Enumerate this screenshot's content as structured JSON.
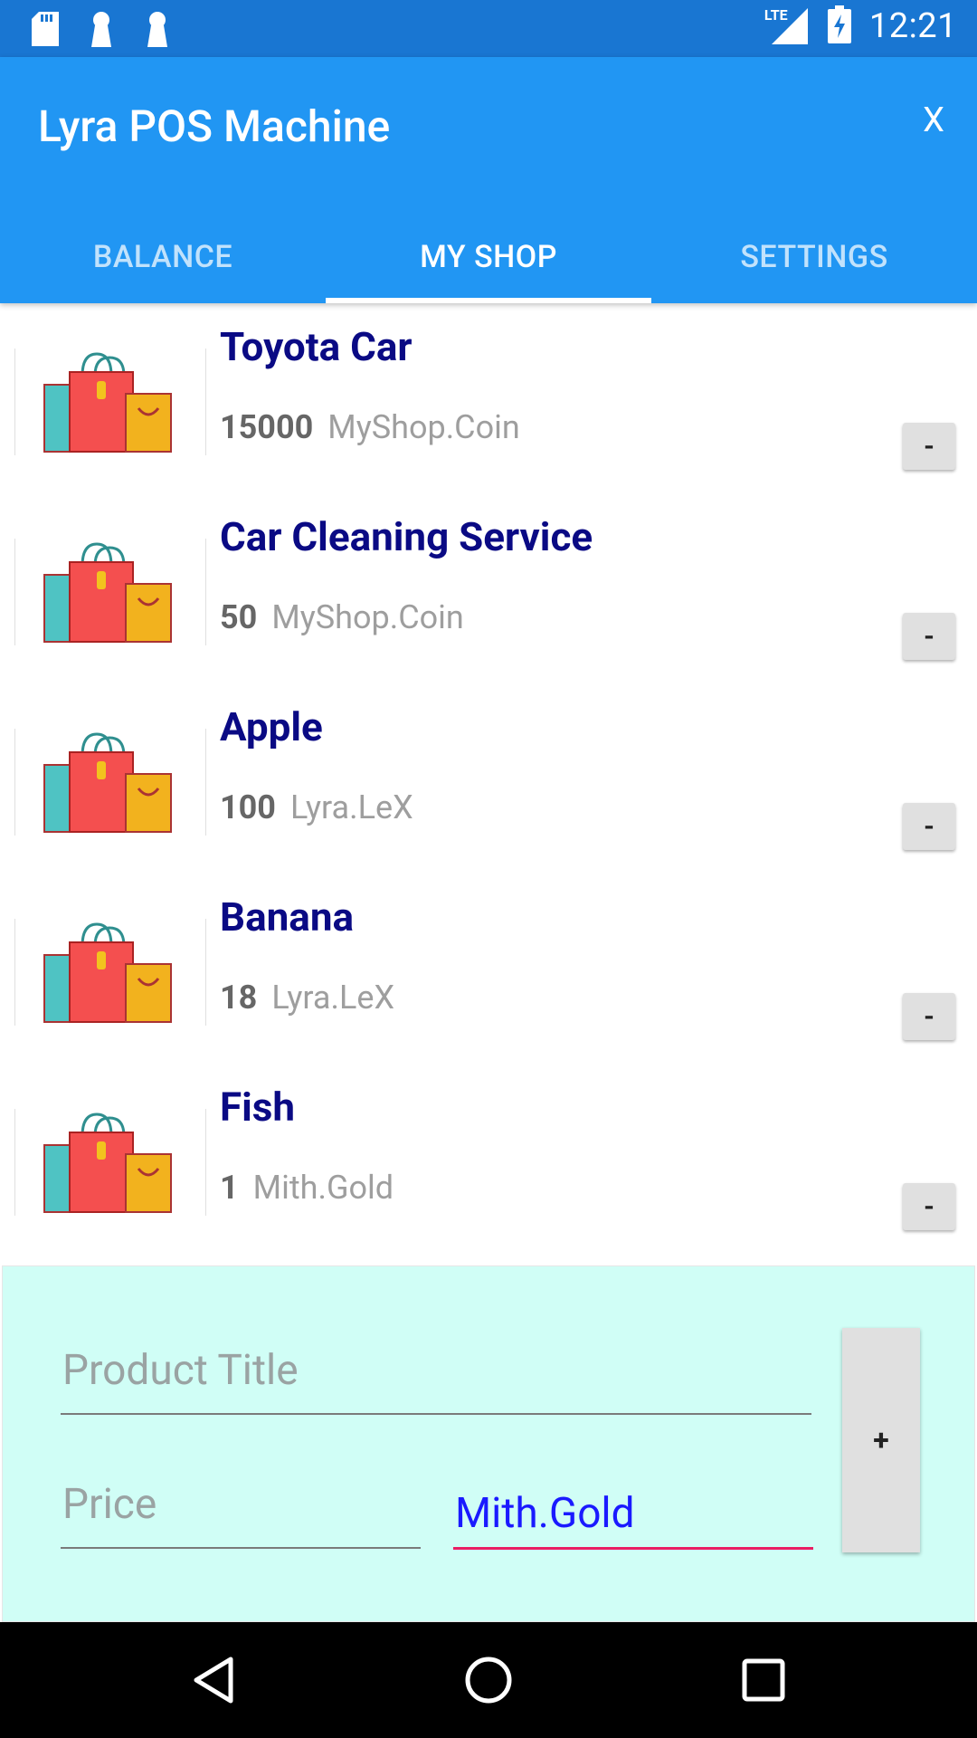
{
  "status_bar": {
    "time": "12:21",
    "network": "LTE",
    "icons": [
      "sd-card-icon",
      "notification-icon",
      "notification-icon",
      "signal-icon",
      "battery-charging-icon"
    ]
  },
  "app_bar": {
    "title": "Lyra POS Machine",
    "close_label": "X"
  },
  "tabs": [
    {
      "label": "BALANCE",
      "active": false
    },
    {
      "label": "MY SHOP",
      "active": true
    },
    {
      "label": "SETTINGS",
      "active": false
    }
  ],
  "products": [
    {
      "title": "Toyota Car",
      "price": "15000",
      "currency": "MyShop.Coin",
      "remove_label": "-"
    },
    {
      "title": "Car Cleaning Service",
      "price": "50",
      "currency": "MyShop.Coin",
      "remove_label": "-"
    },
    {
      "title": "Apple",
      "price": "100",
      "currency": "Lyra.LeX",
      "remove_label": "-"
    },
    {
      "title": "Banana",
      "price": "18",
      "currency": "Lyra.LeX",
      "remove_label": "-"
    },
    {
      "title": "Fish",
      "price": "1",
      "currency": "Mith.Gold",
      "remove_label": "-"
    }
  ],
  "add_form": {
    "title_placeholder": "Product Title",
    "price_placeholder": "Price",
    "currency_value": "Mith.Gold",
    "add_label": "+"
  },
  "colors": {
    "status_bar": "#1976d2",
    "app_bar": "#2196f3",
    "product_title": "#0a0a84",
    "panel_bg": "#d0fef6",
    "accent": "#e91e63"
  }
}
